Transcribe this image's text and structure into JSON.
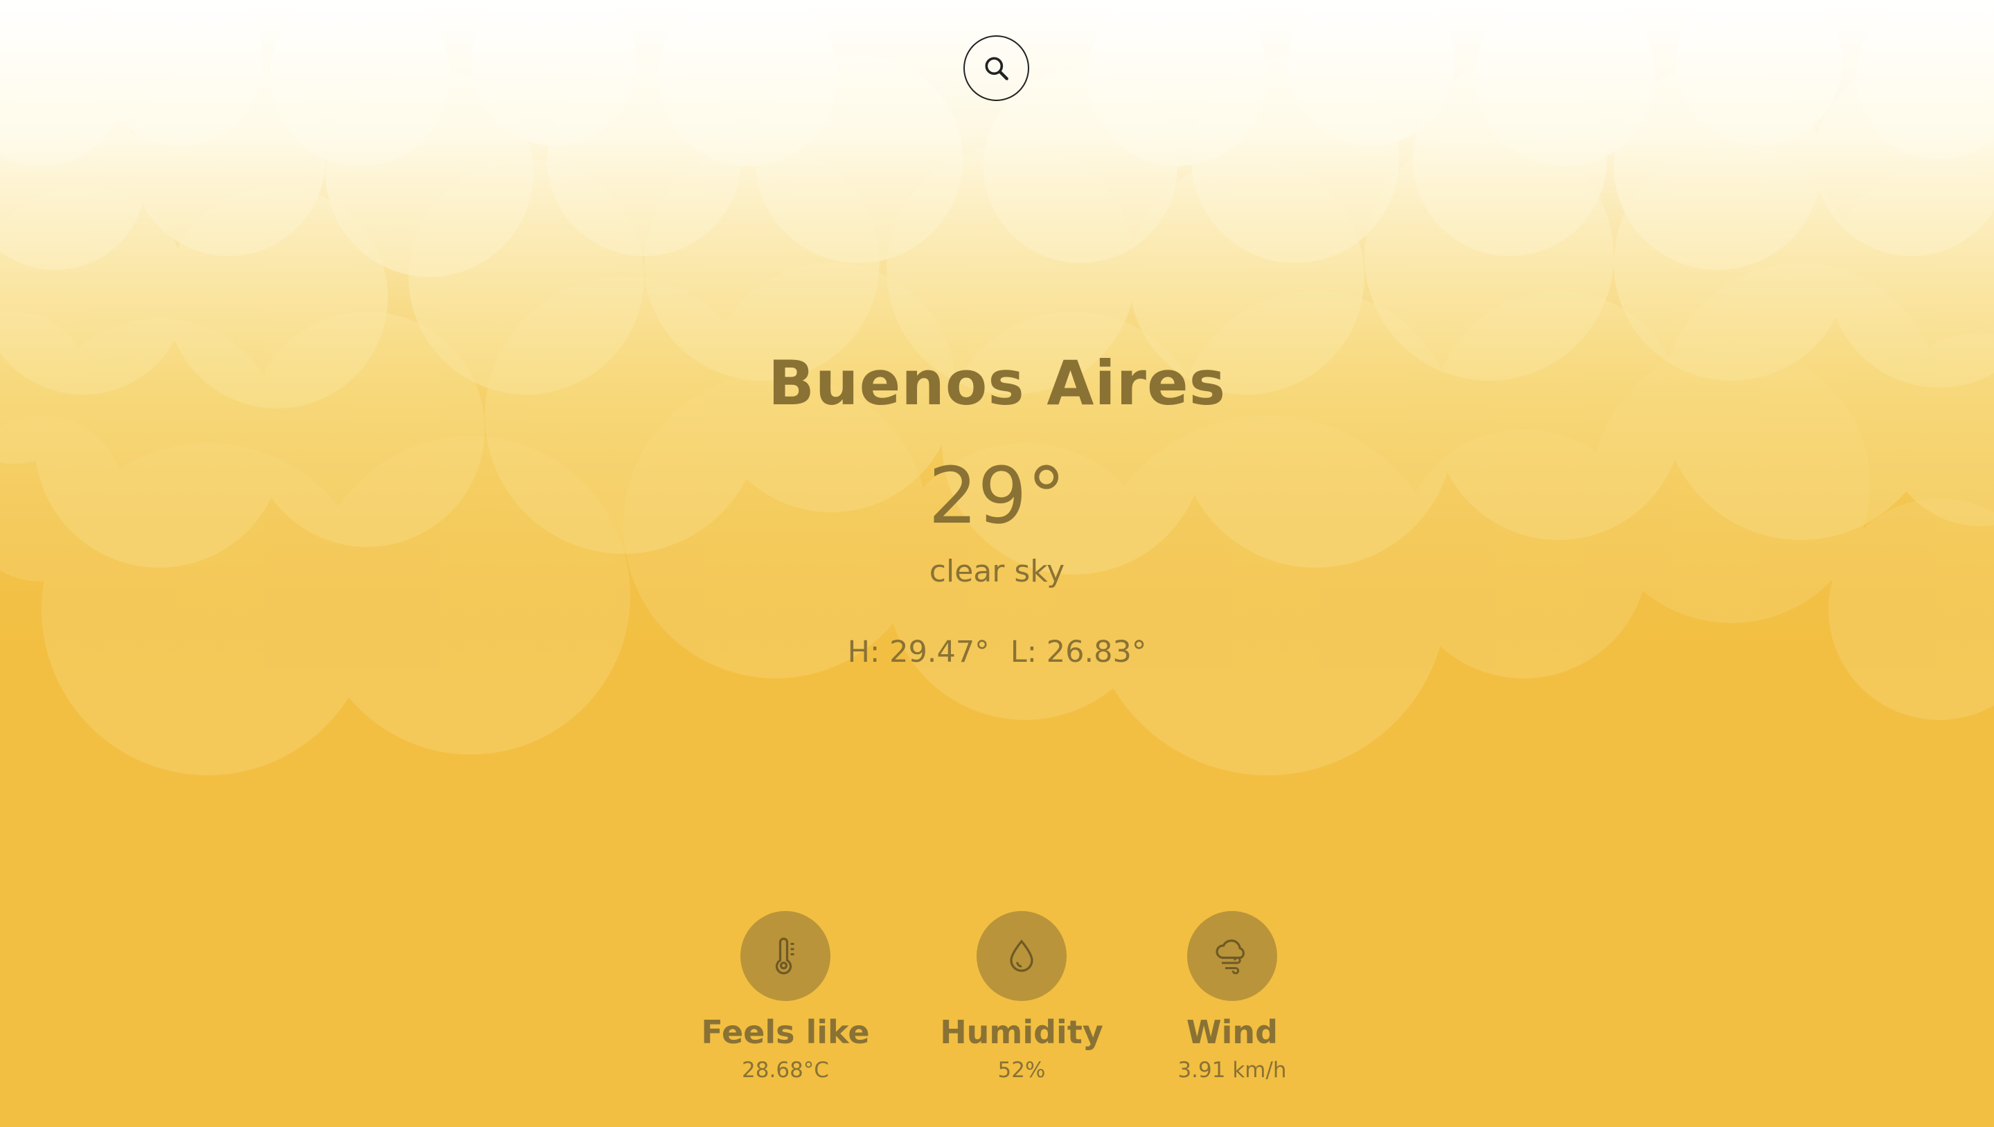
{
  "search": {
    "icon": "search-icon"
  },
  "location": {
    "city": "Buenos Aires"
  },
  "current": {
    "temperature": "29°",
    "description": "clear sky",
    "high": "H: 29.47°",
    "low": "L: 26.83°"
  },
  "stats": {
    "feels_like": {
      "label": "Feels like",
      "value": "28.68°C",
      "icon": "thermometer-icon"
    },
    "humidity": {
      "label": "Humidity",
      "value": "52%",
      "icon": "droplet-icon"
    },
    "wind": {
      "label": "Wind",
      "value": "3.91 km/h",
      "icon": "cloud-wind-icon"
    }
  },
  "colors": {
    "background": "#f2bf42",
    "text": "#8a7235",
    "stat_circle": "#b9943a",
    "cloud": "#ffffff"
  }
}
